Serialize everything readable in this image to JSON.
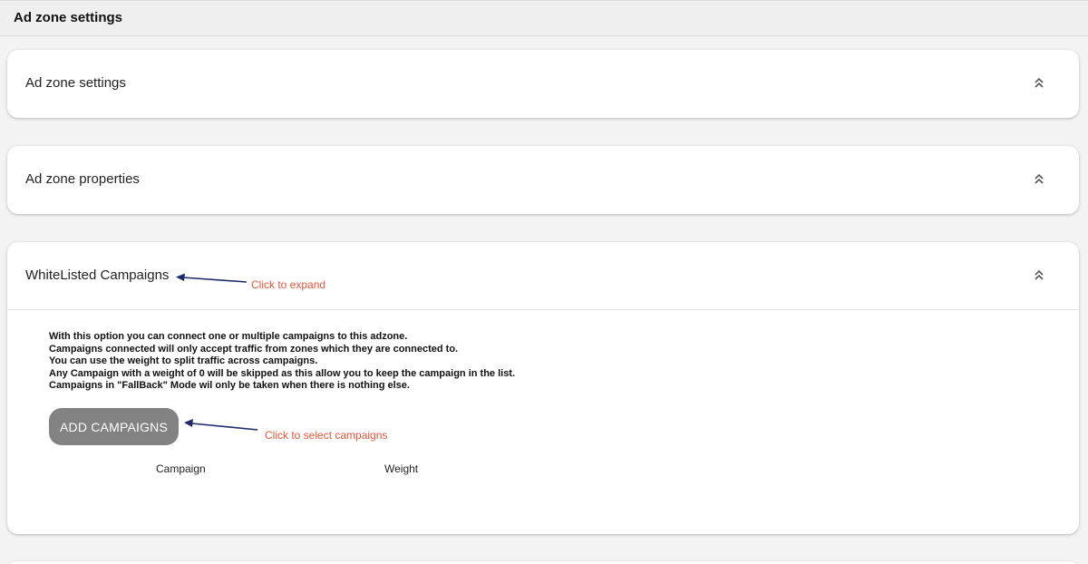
{
  "page": {
    "title": "Ad zone settings"
  },
  "sections": [
    {
      "title": "Ad zone settings",
      "icon": "chevron-double-up-icon"
    },
    {
      "title": "Ad zone properties",
      "icon": "chevron-double-up-icon"
    },
    {
      "title": "WhiteListed Campaigns",
      "icon": "chevron-double-up-icon"
    }
  ],
  "whitelist": {
    "description": [
      "With this option you can connect one or multiple campaigns to this adzone.",
      "Campaigns connected will only accept traffic from zones which they are connected to.",
      "You can use the weight to split traffic across campaigns.",
      "Any Campaign with a weight of 0 will be skipped as this allow you to keep the campaign in the list.",
      "Campaigns in \"FallBack\" Mode wil only be taken when there is nothing else."
    ],
    "add_button": "ADD CAMPAIGNS",
    "columns": [
      "Campaign",
      "Weight"
    ]
  },
  "annotations": {
    "expand": "Click to expand",
    "select": "Click to select campaigns"
  },
  "colors": {
    "annotation_text": "#e0553a",
    "arrow": "#1f2a6b",
    "button_bg": "#828282"
  }
}
